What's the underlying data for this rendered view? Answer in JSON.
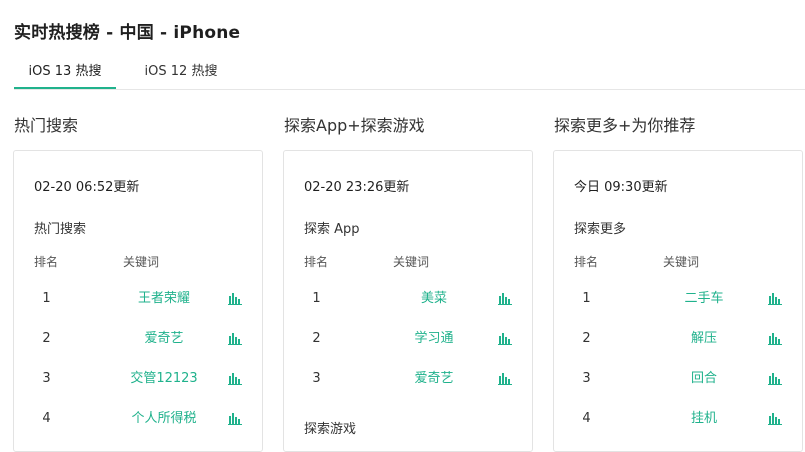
{
  "page_title": "实时热搜榜 - 中国 - iPhone",
  "tabs": [
    {
      "label": "iOS 13 热搜",
      "active": true
    },
    {
      "label": "iOS 12 热搜",
      "active": false
    }
  ],
  "colors": {
    "accent": "#20b28c",
    "text": "#333333",
    "border": "#e3e3e3"
  },
  "icons": {
    "trend": "bar-chart-icon"
  },
  "columns": [
    {
      "heading": "热门搜索",
      "updated": "02-20 06:52更新",
      "section": "热门搜索",
      "header_rank": "排名",
      "header_keyword": "关键词",
      "rows": [
        {
          "rank": "1",
          "keyword": "王者荣耀"
        },
        {
          "rank": "2",
          "keyword": "爱奇艺"
        },
        {
          "rank": "3",
          "keyword": "交管12123"
        },
        {
          "rank": "4",
          "keyword": "个人所得税"
        }
      ]
    },
    {
      "heading": "探索App+探索游戏",
      "updated": "02-20 23:26更新",
      "section": "探索 App",
      "header_rank": "排名",
      "header_keyword": "关键词",
      "rows": [
        {
          "rank": "1",
          "keyword": "美菜"
        },
        {
          "rank": "2",
          "keyword": "学习通"
        },
        {
          "rank": "3",
          "keyword": "爱奇艺"
        }
      ],
      "section2": "探索游戏"
    },
    {
      "heading": "探索更多+为你推荐",
      "updated": "今日 09:30更新",
      "section": "探索更多",
      "header_rank": "排名",
      "header_keyword": "关键词",
      "rows": [
        {
          "rank": "1",
          "keyword": "二手车"
        },
        {
          "rank": "2",
          "keyword": "解压"
        },
        {
          "rank": "3",
          "keyword": "回合"
        },
        {
          "rank": "4",
          "keyword": "挂机"
        }
      ]
    }
  ]
}
